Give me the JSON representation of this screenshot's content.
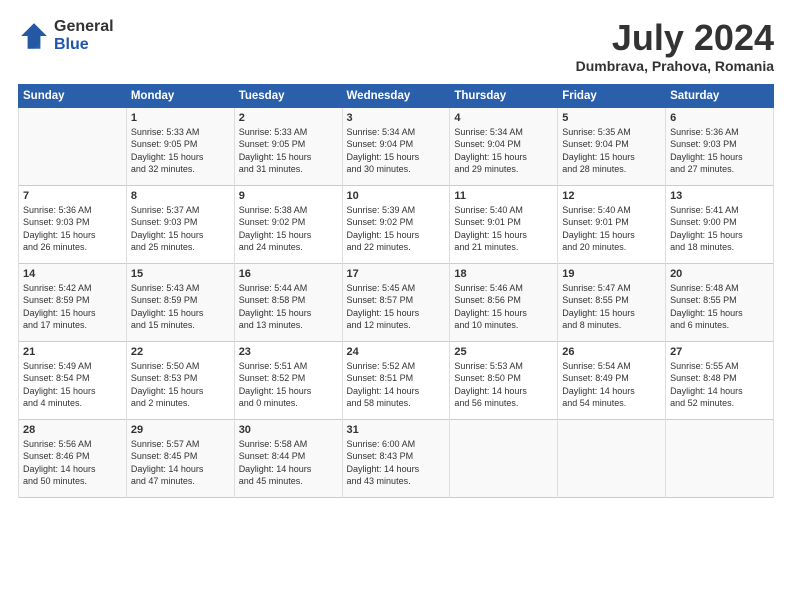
{
  "logo": {
    "general": "General",
    "blue": "Blue"
  },
  "title": {
    "month_year": "July 2024",
    "location": "Dumbrava, Prahova, Romania"
  },
  "headers": [
    "Sunday",
    "Monday",
    "Tuesday",
    "Wednesday",
    "Thursday",
    "Friday",
    "Saturday"
  ],
  "weeks": [
    [
      {
        "day": "",
        "info": ""
      },
      {
        "day": "1",
        "info": "Sunrise: 5:33 AM\nSunset: 9:05 PM\nDaylight: 15 hours\nand 32 minutes."
      },
      {
        "day": "2",
        "info": "Sunrise: 5:33 AM\nSunset: 9:05 PM\nDaylight: 15 hours\nand 31 minutes."
      },
      {
        "day": "3",
        "info": "Sunrise: 5:34 AM\nSunset: 9:04 PM\nDaylight: 15 hours\nand 30 minutes."
      },
      {
        "day": "4",
        "info": "Sunrise: 5:34 AM\nSunset: 9:04 PM\nDaylight: 15 hours\nand 29 minutes."
      },
      {
        "day": "5",
        "info": "Sunrise: 5:35 AM\nSunset: 9:04 PM\nDaylight: 15 hours\nand 28 minutes."
      },
      {
        "day": "6",
        "info": "Sunrise: 5:36 AM\nSunset: 9:03 PM\nDaylight: 15 hours\nand 27 minutes."
      }
    ],
    [
      {
        "day": "7",
        "info": "Sunrise: 5:36 AM\nSunset: 9:03 PM\nDaylight: 15 hours\nand 26 minutes."
      },
      {
        "day": "8",
        "info": "Sunrise: 5:37 AM\nSunset: 9:03 PM\nDaylight: 15 hours\nand 25 minutes."
      },
      {
        "day": "9",
        "info": "Sunrise: 5:38 AM\nSunset: 9:02 PM\nDaylight: 15 hours\nand 24 minutes."
      },
      {
        "day": "10",
        "info": "Sunrise: 5:39 AM\nSunset: 9:02 PM\nDaylight: 15 hours\nand 22 minutes."
      },
      {
        "day": "11",
        "info": "Sunrise: 5:40 AM\nSunset: 9:01 PM\nDaylight: 15 hours\nand 21 minutes."
      },
      {
        "day": "12",
        "info": "Sunrise: 5:40 AM\nSunset: 9:01 PM\nDaylight: 15 hours\nand 20 minutes."
      },
      {
        "day": "13",
        "info": "Sunrise: 5:41 AM\nSunset: 9:00 PM\nDaylight: 15 hours\nand 18 minutes."
      }
    ],
    [
      {
        "day": "14",
        "info": "Sunrise: 5:42 AM\nSunset: 8:59 PM\nDaylight: 15 hours\nand 17 minutes."
      },
      {
        "day": "15",
        "info": "Sunrise: 5:43 AM\nSunset: 8:59 PM\nDaylight: 15 hours\nand 15 minutes."
      },
      {
        "day": "16",
        "info": "Sunrise: 5:44 AM\nSunset: 8:58 PM\nDaylight: 15 hours\nand 13 minutes."
      },
      {
        "day": "17",
        "info": "Sunrise: 5:45 AM\nSunset: 8:57 PM\nDaylight: 15 hours\nand 12 minutes."
      },
      {
        "day": "18",
        "info": "Sunrise: 5:46 AM\nSunset: 8:56 PM\nDaylight: 15 hours\nand 10 minutes."
      },
      {
        "day": "19",
        "info": "Sunrise: 5:47 AM\nSunset: 8:55 PM\nDaylight: 15 hours\nand 8 minutes."
      },
      {
        "day": "20",
        "info": "Sunrise: 5:48 AM\nSunset: 8:55 PM\nDaylight: 15 hours\nand 6 minutes."
      }
    ],
    [
      {
        "day": "21",
        "info": "Sunrise: 5:49 AM\nSunset: 8:54 PM\nDaylight: 15 hours\nand 4 minutes."
      },
      {
        "day": "22",
        "info": "Sunrise: 5:50 AM\nSunset: 8:53 PM\nDaylight: 15 hours\nand 2 minutes."
      },
      {
        "day": "23",
        "info": "Sunrise: 5:51 AM\nSunset: 8:52 PM\nDaylight: 15 hours\nand 0 minutes."
      },
      {
        "day": "24",
        "info": "Sunrise: 5:52 AM\nSunset: 8:51 PM\nDaylight: 14 hours\nand 58 minutes."
      },
      {
        "day": "25",
        "info": "Sunrise: 5:53 AM\nSunset: 8:50 PM\nDaylight: 14 hours\nand 56 minutes."
      },
      {
        "day": "26",
        "info": "Sunrise: 5:54 AM\nSunset: 8:49 PM\nDaylight: 14 hours\nand 54 minutes."
      },
      {
        "day": "27",
        "info": "Sunrise: 5:55 AM\nSunset: 8:48 PM\nDaylight: 14 hours\nand 52 minutes."
      }
    ],
    [
      {
        "day": "28",
        "info": "Sunrise: 5:56 AM\nSunset: 8:46 PM\nDaylight: 14 hours\nand 50 minutes."
      },
      {
        "day": "29",
        "info": "Sunrise: 5:57 AM\nSunset: 8:45 PM\nDaylight: 14 hours\nand 47 minutes."
      },
      {
        "day": "30",
        "info": "Sunrise: 5:58 AM\nSunset: 8:44 PM\nDaylight: 14 hours\nand 45 minutes."
      },
      {
        "day": "31",
        "info": "Sunrise: 6:00 AM\nSunset: 8:43 PM\nDaylight: 14 hours\nand 43 minutes."
      },
      {
        "day": "",
        "info": ""
      },
      {
        "day": "",
        "info": ""
      },
      {
        "day": "",
        "info": ""
      }
    ]
  ]
}
